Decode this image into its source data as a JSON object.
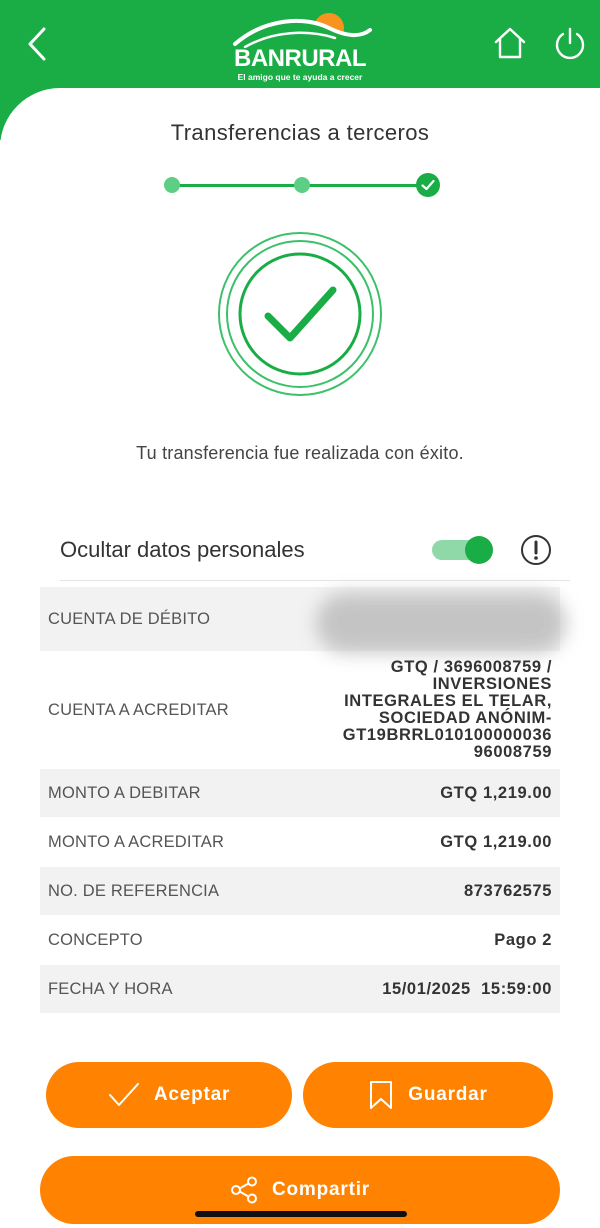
{
  "header": {
    "brand_name": "BANRURAL",
    "brand_tagline": "El amigo que te ayuda a crecer",
    "back_icon": "chevron-left-icon",
    "home_icon": "home-icon",
    "power_icon": "power-icon"
  },
  "page": {
    "title": "Transferencias a terceros",
    "success_message": "Tu transferencia fue realizada con éxito.",
    "steps": {
      "total": 3,
      "current": 3
    }
  },
  "privacy": {
    "label": "Ocultar datos personales",
    "toggle_on": true,
    "info_icon": "exclamation-circle-icon"
  },
  "details": [
    {
      "label": "CUENTA DE DÉBITO",
      "value": ""
    },
    {
      "label": "CUENTA A ACREDITAR",
      "value_lines": [
        "GTQ / 3696008759 /",
        "INVERSIONES",
        "INTEGRALES EL TELAR,",
        "SOCIEDAD ANÓNIM-",
        "GT19BRRL010100000036",
        "96008759"
      ]
    },
    {
      "label": "MONTO A DEBITAR",
      "value": "GTQ 1,219.00"
    },
    {
      "label": "MONTO A ACREDITAR",
      "value": "GTQ 1,219.00"
    },
    {
      "label": "NO. DE REFERENCIA",
      "value": "873762575"
    },
    {
      "label": "CONCEPTO",
      "value": "Pago 2"
    },
    {
      "label": "FECHA Y HORA",
      "value": "15/01/2025  15:59:00"
    }
  ],
  "actions": {
    "accept_label": "Aceptar",
    "save_label": "Guardar",
    "share_label": "Compartir"
  },
  "colors": {
    "brand_green": "#1aad46",
    "action_orange": "#ff8200"
  }
}
